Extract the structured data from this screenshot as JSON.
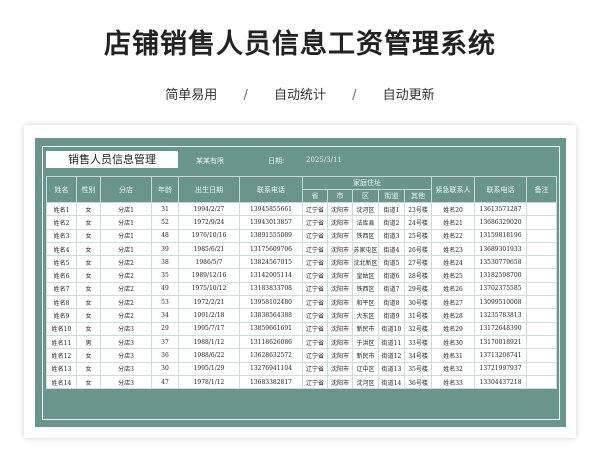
{
  "page": {
    "title": "店铺销售人员信息工资管理系统",
    "tags": [
      "简单易用",
      "自动统计",
      "自动更新"
    ],
    "separator": "/"
  },
  "sheet": {
    "title": "销售人员信息管理",
    "company_label": "某某有限",
    "date_label": "日期:",
    "date_value": "2025/3/11",
    "columns": [
      "姓名",
      "性别",
      "分店",
      "年龄",
      "出生日期",
      "联系电话",
      "家庭住址",
      "紧急联系人",
      "联系电话",
      "备注"
    ],
    "address_subcolumns": [
      "省",
      "市",
      "区",
      "街道",
      "其他"
    ],
    "rows": [
      [
        "姓名1",
        "女",
        "分店1",
        "31",
        "1994/2/27",
        "13945855661",
        "辽宁省",
        "沈阳市",
        "沈河区",
        "街道1",
        "23号楼",
        "姓名20",
        "13613571287",
        ""
      ],
      [
        "姓名2",
        "女",
        "分店1",
        "52",
        "1972/9/24",
        "13943013857",
        "辽宁省",
        "沈阳市",
        "法库县",
        "街道2",
        "24号楼",
        "姓名21",
        "13686329020",
        ""
      ],
      [
        "姓名3",
        "女",
        "分店1",
        "48",
        "1976/10/16",
        "13891555089",
        "辽宁省",
        "沈阳市",
        "铁西区",
        "街道3",
        "25号楼",
        "姓名22",
        "13159818196",
        ""
      ],
      [
        "姓名4",
        "女",
        "分店1",
        "39",
        "1985/6/21",
        "13175609706",
        "辽宁省",
        "沈阳市",
        "苏家屯区",
        "街道4",
        "26号楼",
        "姓名23",
        "13689301933",
        ""
      ],
      [
        "姓名5",
        "女",
        "分店2",
        "38",
        "1986/5/7",
        "13824567015",
        "辽宁省",
        "沈阳市",
        "沈北新区",
        "街道5",
        "27号楼",
        "姓名24",
        "13530779658",
        ""
      ],
      [
        "姓名6",
        "女",
        "分店2",
        "35",
        "1989/12/16",
        "13142005114",
        "辽宁省",
        "沈阳市",
        "皇姑区",
        "街道6",
        "28号楼",
        "姓名25",
        "13182598700",
        ""
      ],
      [
        "姓名7",
        "女",
        "分店2",
        "49",
        "1975/10/12",
        "13183833708",
        "辽宁省",
        "沈阳市",
        "铁西区",
        "街道7",
        "29号楼",
        "姓名26",
        "13702375585",
        ""
      ],
      [
        "姓名8",
        "女",
        "分店2",
        "53",
        "1972/2/21",
        "13958102480",
        "辽宁省",
        "沈阳市",
        "和平区",
        "街道8",
        "30号楼",
        "姓名27",
        "13099510008",
        ""
      ],
      [
        "姓名9",
        "女",
        "分店2",
        "34",
        "1991/2/18",
        "13838564388",
        "辽宁省",
        "沈阳市",
        "大东区",
        "街道9",
        "31号楼",
        "姓名28",
        "13235783813",
        ""
      ],
      [
        "姓名10",
        "女",
        "分店3",
        "29",
        "1995/7/17",
        "13859661691",
        "辽宁省",
        "沈阳市",
        "新民市",
        "街道10",
        "32号楼",
        "姓名29",
        "13172648390",
        ""
      ],
      [
        "姓名11",
        "男",
        "分店3",
        "37",
        "1988/1/12",
        "13118626086",
        "辽宁省",
        "沈阳市",
        "于洪区",
        "街道11",
        "33号楼",
        "姓名30",
        "13170018921",
        ""
      ],
      [
        "姓名12",
        "女",
        "分店3",
        "36",
        "1988/6/22",
        "13628632572",
        "辽宁省",
        "沈阳市",
        "新民市",
        "街道12",
        "34号楼",
        "姓名31",
        "13713208741",
        ""
      ],
      [
        "姓名13",
        "女",
        "分店3",
        "30",
        "1995/1/29",
        "13276941104",
        "辽宁省",
        "沈阳市",
        "辽中区",
        "街道13",
        "35号楼",
        "姓名32",
        "13721997937",
        ""
      ],
      [
        "姓名14",
        "女",
        "分店3",
        "47",
        "1978/1/12",
        "13683382817",
        "辽宁省",
        "沈阳市",
        "沈河区",
        "街道14",
        "36号楼",
        "姓名33",
        "13304437218",
        ""
      ]
    ]
  }
}
